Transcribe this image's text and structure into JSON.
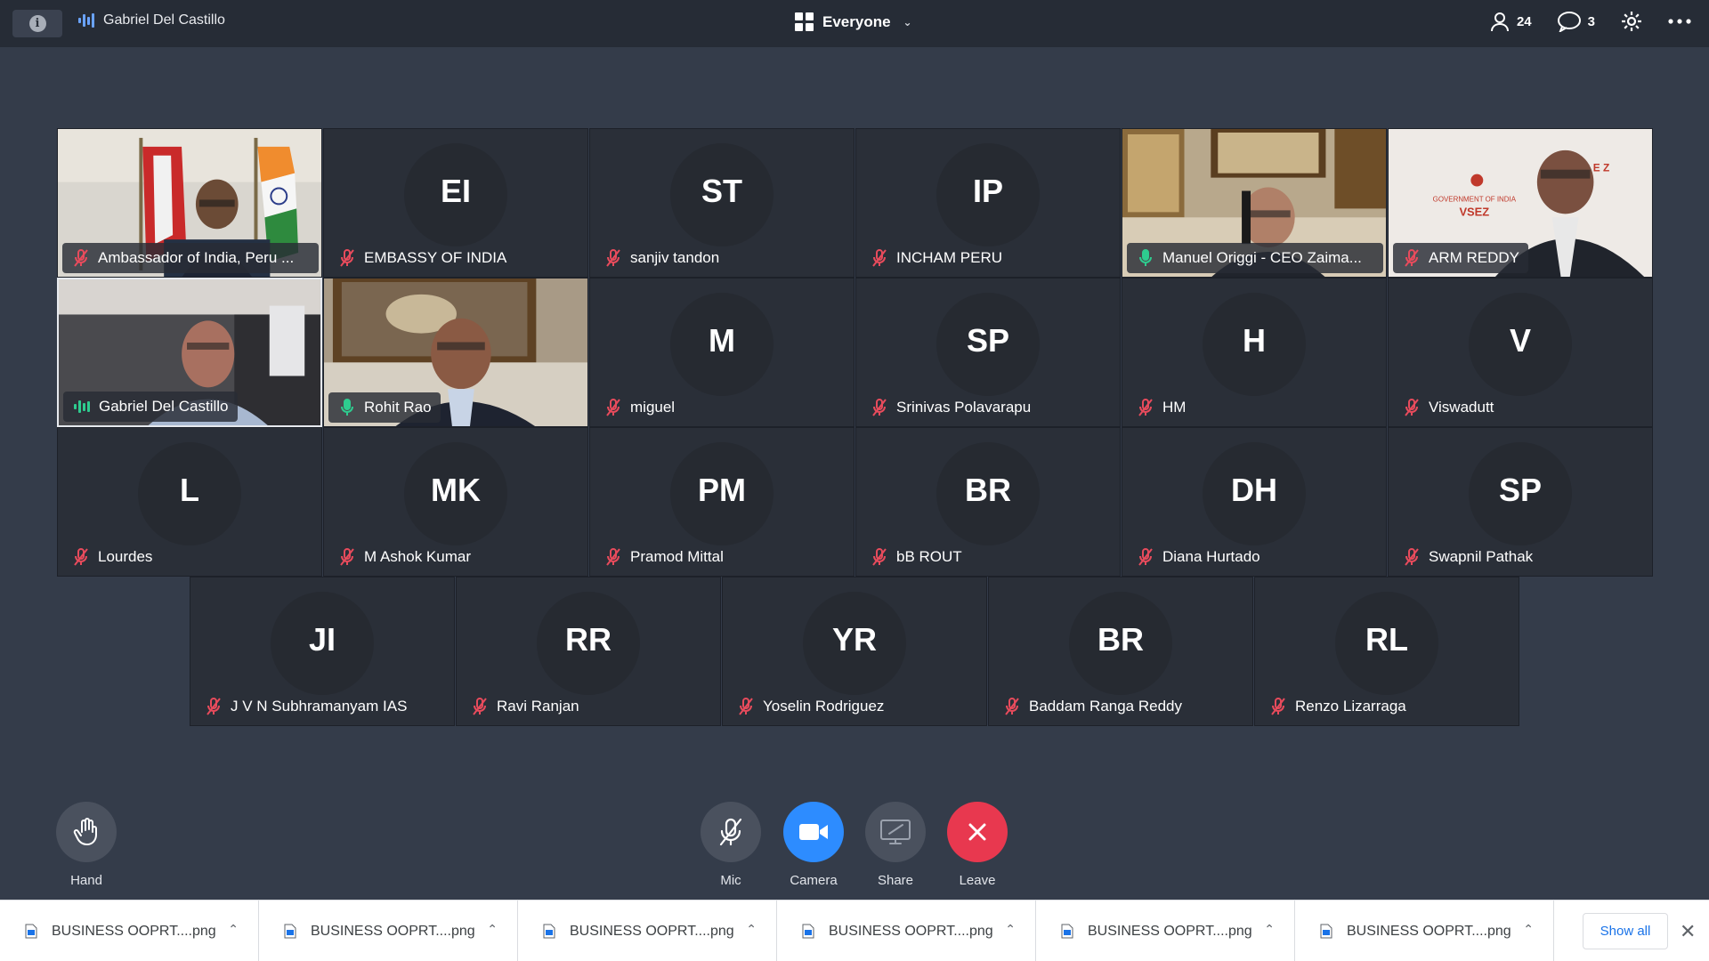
{
  "topbar": {
    "active_speaker": "Gabriel Del Castillo",
    "view_label": "Everyone",
    "participants_count": "24",
    "chat_count": "3"
  },
  "tiles": [
    {
      "name": "Ambassador of India, Peru ...",
      "initials": "",
      "video": true,
      "mic": "muted"
    },
    {
      "name": "EMBASSY OF INDIA",
      "initials": "EI",
      "video": false,
      "mic": "muted"
    },
    {
      "name": "sanjiv tandon",
      "initials": "ST",
      "video": false,
      "mic": "muted"
    },
    {
      "name": "INCHAM PERU",
      "initials": "IP",
      "video": false,
      "mic": "muted"
    },
    {
      "name": "Manuel Origgi - CEO Zaima...",
      "initials": "",
      "video": true,
      "mic": "on"
    },
    {
      "name": "ARM REDDY",
      "initials": "",
      "video": true,
      "mic": "muted"
    },
    {
      "name": "Gabriel Del Castillo",
      "initials": "",
      "video": true,
      "mic": "speaking"
    },
    {
      "name": "Rohit Rao",
      "initials": "",
      "video": true,
      "mic": "on"
    },
    {
      "name": "miguel",
      "initials": "M",
      "video": false,
      "mic": "muted"
    },
    {
      "name": "Srinivas Polavarapu",
      "initials": "SP",
      "video": false,
      "mic": "muted"
    },
    {
      "name": "HM",
      "initials": "H",
      "video": false,
      "mic": "muted"
    },
    {
      "name": "Viswadutt",
      "initials": "V",
      "video": false,
      "mic": "muted"
    },
    {
      "name": "Lourdes",
      "initials": "L",
      "video": false,
      "mic": "muted"
    },
    {
      "name": "M Ashok Kumar",
      "initials": "MK",
      "video": false,
      "mic": "muted"
    },
    {
      "name": "Pramod Mittal",
      "initials": "PM",
      "video": false,
      "mic": "muted"
    },
    {
      "name": "bB ROUT",
      "initials": "BR",
      "video": false,
      "mic": "muted"
    },
    {
      "name": "Diana Hurtado",
      "initials": "DH",
      "video": false,
      "mic": "muted"
    },
    {
      "name": "Swapnil Pathak",
      "initials": "SP",
      "video": false,
      "mic": "muted"
    },
    {
      "name": "J V N Subhramanyam IAS",
      "initials": "JI",
      "video": false,
      "mic": "muted"
    },
    {
      "name": "Ravi Ranjan",
      "initials": "RR",
      "video": false,
      "mic": "muted"
    },
    {
      "name": "Yoselin Rodriguez",
      "initials": "YR",
      "video": false,
      "mic": "muted"
    },
    {
      "name": "Baddam Ranga Reddy",
      "initials": "BR",
      "video": false,
      "mic": "muted"
    },
    {
      "name": "Renzo Lizarraga",
      "initials": "RL",
      "video": false,
      "mic": "muted"
    }
  ],
  "controls": {
    "hand": "Hand",
    "mic": "Mic",
    "camera": "Camera",
    "share": "Share",
    "leave": "Leave"
  },
  "downloads": {
    "items": [
      "BUSINESS OOPRT....png",
      "BUSINESS OOPRT....png",
      "BUSINESS OOPRT....png",
      "BUSINESS OOPRT....png",
      "BUSINESS OOPRT....png",
      "BUSINESS OOPRT....png"
    ],
    "show_all": "Show all"
  },
  "colors": {
    "background": "#343c4a",
    "topbar": "#262c36",
    "tile": "#2a2f38",
    "mic_muted": "#e84b5c",
    "mic_on": "#2ecc8f",
    "camera_button": "#2d8cff",
    "leave_button": "#e8384f"
  }
}
